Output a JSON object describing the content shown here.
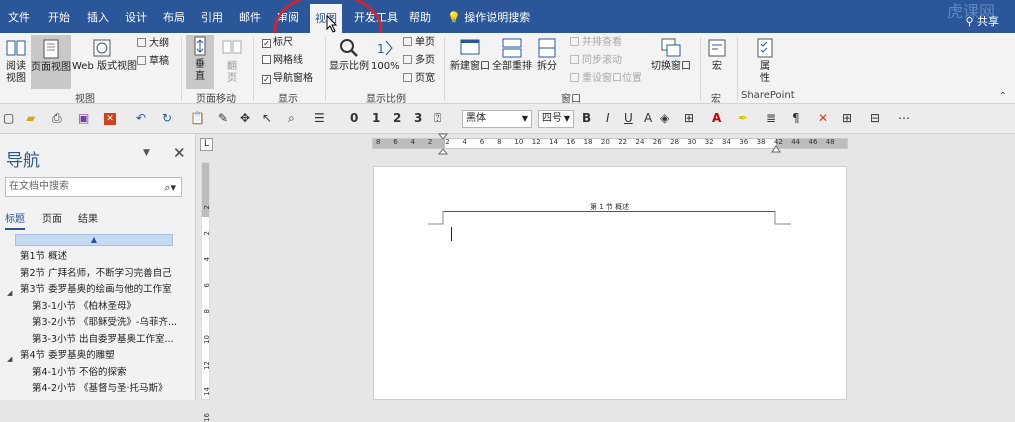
{
  "menubar": {
    "tabs": [
      "文件",
      "开始",
      "插入",
      "设计",
      "布局",
      "引用",
      "邮件",
      "审阅",
      "视图",
      "开发工具",
      "帮助"
    ],
    "active": "视图",
    "tell_me": "操作说明搜索",
    "share": "共享",
    "watermark": "虎课网"
  },
  "ribbon": {
    "views": {
      "read": "阅读\n视图",
      "print": "页面视图",
      "web": "Web 版式视图",
      "outline": "大纲",
      "draft": "草稿",
      "label": "视图"
    },
    "page_movement": {
      "vertical": "垂\n直",
      "side": "翻\n页",
      "label": "页面移动"
    },
    "show": {
      "ruler": "标尺",
      "gridlines": "网格线",
      "nav_pane": "导航窗格",
      "label": "显示"
    },
    "zoom": {
      "zoom": "显示比例",
      "percent": "100%",
      "one_page": "单页",
      "multi_page": "多页",
      "page_width": "页宽",
      "label": "显示比例"
    },
    "window": {
      "new": "新建窗口",
      "arrange": "全部重排",
      "split": "拆分",
      "side_by_side": "并排查看",
      "sync_scroll": "同步滚动",
      "reset_pos": "重设窗口位置",
      "switch": "切换窗口",
      "label": "窗口"
    },
    "macros": {
      "macro": "宏",
      "label": "宏"
    },
    "sharepoint": {
      "props": "属\n性",
      "label": "SharePoint"
    }
  },
  "toolbar": {
    "font": "黑体",
    "size": "四号",
    "numbers": [
      "0",
      "1",
      "2",
      "3"
    ],
    "bold": "B",
    "italic": "I",
    "underline": "U"
  },
  "nav": {
    "title": "导航",
    "search_placeholder": "在文档中搜索",
    "tabs": [
      "标题",
      "页面",
      "结果"
    ],
    "headings": [
      {
        "text": "第1节 概述",
        "level": 1
      },
      {
        "text": "第2节 广拜名师，不断学习完善自己",
        "level": 1
      },
      {
        "text": "第3节 委罗基奥的绘画与他的工作室",
        "level": 1
      },
      {
        "text": "第3-1小节 《柏林圣母》",
        "level": 2
      },
      {
        "text": "第3-2小节 《耶稣受洗》-乌菲齐...",
        "level": 2
      },
      {
        "text": "第3-3小节 出自委罗基奥工作室...",
        "level": 2
      },
      {
        "text": "第4节 委罗基奥的雕塑",
        "level": 1
      },
      {
        "text": "第4-1小节 不俗的探索",
        "level": 2
      },
      {
        "text": "第4-2小节 《基督与圣·托马斯》",
        "level": 2
      }
    ]
  },
  "ruler": {
    "h_numbers": [
      "8",
      "6",
      "4",
      "2",
      "2",
      "4",
      "6",
      "8",
      "10",
      "12",
      "14",
      "16",
      "18",
      "20",
      "22",
      "24",
      "26",
      "28",
      "30",
      "32",
      "34",
      "36",
      "38",
      "42",
      "44",
      "46",
      "48"
    ],
    "v_numbers": [
      "2",
      "2",
      "4",
      "6",
      "8",
      "10",
      "12",
      "14",
      "16"
    ]
  },
  "document": {
    "header_text": "第 1 节 概述"
  }
}
